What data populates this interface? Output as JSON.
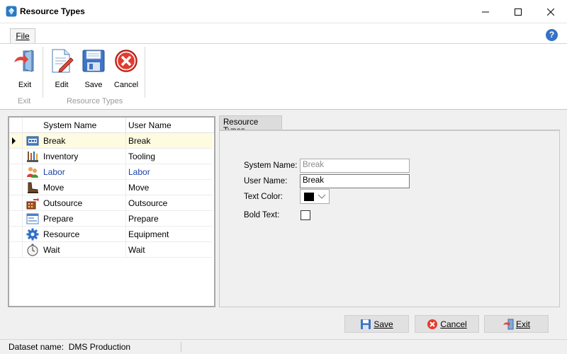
{
  "window": {
    "title": "Resource Types"
  },
  "ribbon": {
    "tabs": [
      {
        "label": "File"
      }
    ],
    "buttons": {
      "exit": "Exit",
      "edit": "Edit",
      "save": "Save",
      "cancel": "Cancel"
    },
    "groups": {
      "exit": "Exit",
      "resource_types": "Resource Types"
    }
  },
  "grid": {
    "columns": [
      "System Name",
      "User Name"
    ],
    "rows": [
      {
        "system": "Break",
        "user": "Break",
        "icon": "break-icon",
        "selected": true
      },
      {
        "system": "Inventory",
        "user": "Tooling",
        "icon": "inventory-icon"
      },
      {
        "system": "Labor",
        "user": "Labor",
        "icon": "labor-icon"
      },
      {
        "system": "Move",
        "user": "Move",
        "icon": "move-icon"
      },
      {
        "system": "Outsource",
        "user": "Outsource",
        "icon": "outsource-icon"
      },
      {
        "system": "Prepare",
        "user": "Prepare",
        "icon": "prepare-icon"
      },
      {
        "system": "Resource",
        "user": "Equipment",
        "icon": "resource-icon"
      },
      {
        "system": "Wait",
        "user": "Wait",
        "icon": "wait-icon"
      }
    ]
  },
  "panel": {
    "tab": "Resource Types",
    "labels": {
      "system_name": "System Name:",
      "user_name": "User Name:",
      "text_color": "Text Color:",
      "bold_text": "Bold Text:"
    },
    "values": {
      "system_name": "Break",
      "user_name": "Break",
      "text_color": "#000000",
      "bold_text": false
    }
  },
  "buttons": {
    "save": "Save",
    "cancel": "Cancel",
    "exit": "Exit"
  },
  "status": {
    "dataset": "Dataset name:  DMS Production"
  }
}
